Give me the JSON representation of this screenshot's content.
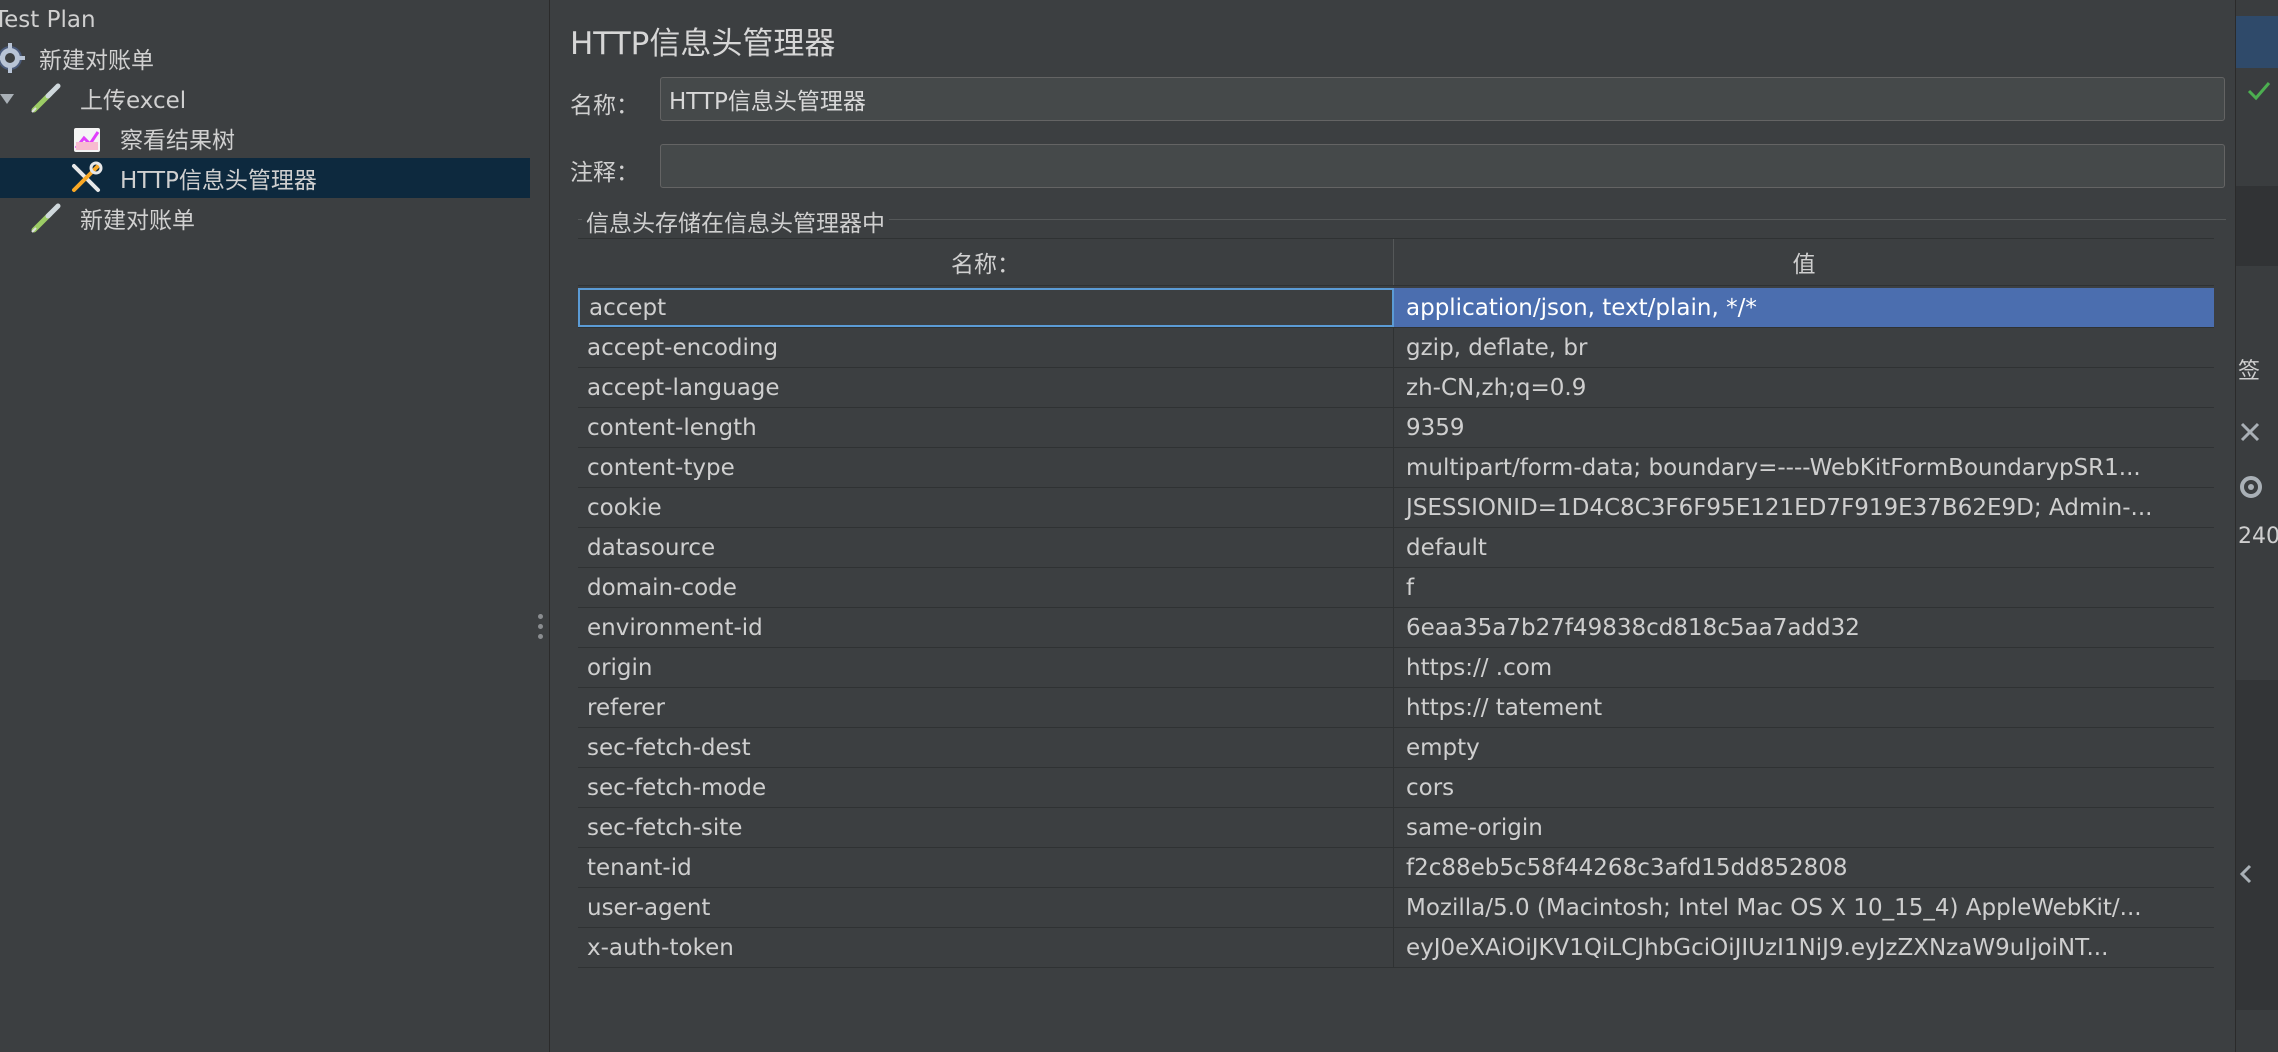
{
  "tree": {
    "items": [
      {
        "label": "Test Plan"
      },
      {
        "label": "新建对账单"
      },
      {
        "label": "上传excel"
      },
      {
        "label": "察看结果树"
      },
      {
        "label": "HTTP信息头管理器"
      },
      {
        "label": "新建对账单"
      }
    ]
  },
  "panel": {
    "title": "HTTP信息头管理器",
    "name_label": "名称：",
    "name_value": "HTTP信息头管理器",
    "comment_label": "注释：",
    "comment_value": "",
    "group_title": "信息头存储在信息头管理器中"
  },
  "table": {
    "headers": {
      "name": "名称：",
      "value": "值"
    },
    "rows": [
      {
        "name": "accept",
        "value": "application/json, text/plain, */*"
      },
      {
        "name": "accept-encoding",
        "value": "gzip, deflate, br"
      },
      {
        "name": "accept-language",
        "value": "zh-CN,zh;q=0.9"
      },
      {
        "name": "content-length",
        "value": "9359"
      },
      {
        "name": "content-type",
        "value": "multipart/form-data; boundary=----WebKitFormBoundarypSR1..."
      },
      {
        "name": "cookie",
        "value": "JSESSIONID=1D4C8C3F6F95E121ED7F919E37B62E9D; Admin-..."
      },
      {
        "name": "datasource",
        "value": "default"
      },
      {
        "name": "domain-code",
        "value": "f"
      },
      {
        "name": "environment-id",
        "value": "6eaa35a7b27f49838cd818c5aa7add32"
      },
      {
        "name": "origin",
        "value": "https://        .com"
      },
      {
        "name": "referer",
        "value": "https://                    tatement"
      },
      {
        "name": "sec-fetch-dest",
        "value": "empty"
      },
      {
        "name": "sec-fetch-mode",
        "value": "cors"
      },
      {
        "name": "sec-fetch-site",
        "value": "same-origin"
      },
      {
        "name": "tenant-id",
        "value": "f2c88eb5c58f44268c3afd15dd852808"
      },
      {
        "name": "user-agent",
        "value": "Mozilla/5.0 (Macintosh; Intel Mac OS X 10_15_4) AppleWebKit/..."
      },
      {
        "name": "x-auth-token",
        "value": "eyJ0eXAiOiJKV1QiLCJhbGciOiJIUzI1NiJ9.eyJzZXNzaW9uIjoiNT..."
      }
    ]
  },
  "right_strip": {
    "text_1": "签",
    "text_2": "240"
  },
  "colors": {
    "background": "#3c3f41",
    "selection": "#4b6eaf",
    "tree_selection": "#0d293e",
    "focus_border": "#5b9bd5"
  }
}
